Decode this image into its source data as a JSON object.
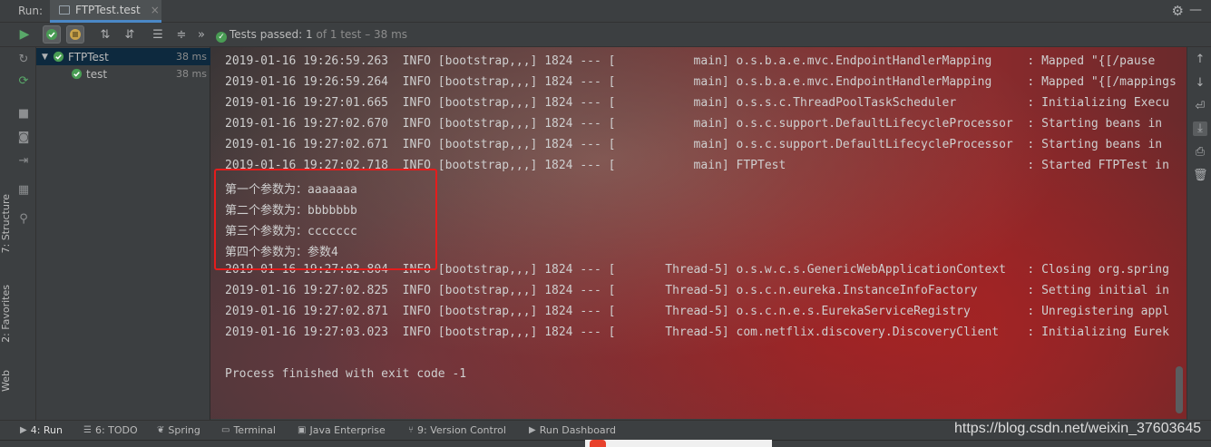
{
  "header": {
    "run_label": "Run:",
    "tab_label": "FTPTest.test",
    "tab_close": "×",
    "settings_glyph": "⚙",
    "minimize_glyph": "—"
  },
  "toolbar": {
    "status_passed": "Tests passed:",
    "status_count": "1",
    "status_detail": "of 1 test – 38 ms"
  },
  "tree": {
    "root": {
      "label": "FTPTest",
      "duration": "38 ms"
    },
    "child": {
      "label": "test",
      "duration": "38 ms"
    }
  },
  "console": {
    "lines": [
      "2019-01-16 19:26:59.263  INFO [bootstrap,,,] 1824 --- [           main] o.s.b.a.e.mvc.EndpointHandlerMapping     : Mapped \"{[/pause",
      "2019-01-16 19:26:59.264  INFO [bootstrap,,,] 1824 --- [           main] o.s.b.a.e.mvc.EndpointHandlerMapping     : Mapped \"{[/mappings",
      "2019-01-16 19:27:01.665  INFO [bootstrap,,,] 1824 --- [           main] o.s.s.c.ThreadPoolTaskScheduler          : Initializing Execu",
      "2019-01-16 19:27:02.670  INFO [bootstrap,,,] 1824 --- [           main] o.s.c.support.DefaultLifecycleProcessor  : Starting beans in",
      "2019-01-16 19:27:02.671  INFO [bootstrap,,,] 1824 --- [           main] o.s.c.support.DefaultLifecycleProcessor  : Starting beans in",
      "2019-01-16 19:27:02.718  INFO [bootstrap,,,] 1824 --- [           main] FTPTest                                  : Started FTPTest in",
      "第一个参数为：aaaaaaa",
      "第二个参数为：bbbbbbb",
      "第三个参数为：ccccccc",
      "第四个参数为：参数4",
      "2019-01-16 19:27:02.804  INFO [bootstrap,,,] 1824 --- [       Thread-5] o.s.w.c.s.GenericWebApplicationContext   : Closing org.spring",
      "2019-01-16 19:27:02.825  INFO [bootstrap,,,] 1824 --- [       Thread-5] o.s.c.n.eureka.InstanceInfoFactory       : Setting initial in",
      "2019-01-16 19:27:02.871  INFO [bootstrap,,,] 1824 --- [       Thread-5] o.s.c.n.e.s.EurekaServiceRegistry        : Unregistering appl",
      "2019-01-16 19:27:03.023  INFO [bootstrap,,,] 1824 --- [       Thread-5] com.netflix.discovery.DiscoveryClient    : Initializing Eurek",
      "",
      "Process finished with exit code -1"
    ]
  },
  "side_tabs": {
    "structure": "7: Structure",
    "favorites": "2: Favorites",
    "web": "Web"
  },
  "bottom_tabs": {
    "run": "4: Run",
    "todo": "6: TODO",
    "spring": "Spring",
    "terminal": "Terminal",
    "java_enterprise": "Java Enterprise",
    "version_control": "9: Version Control",
    "run_dashboard": "Run Dashboard"
  },
  "watermark": "https://blog.csdn.net/weixin_37603645",
  "colors": {
    "pass_green": "#499c54",
    "highlight_red": "#e51c1c",
    "accent_blue": "#4a88c7"
  }
}
